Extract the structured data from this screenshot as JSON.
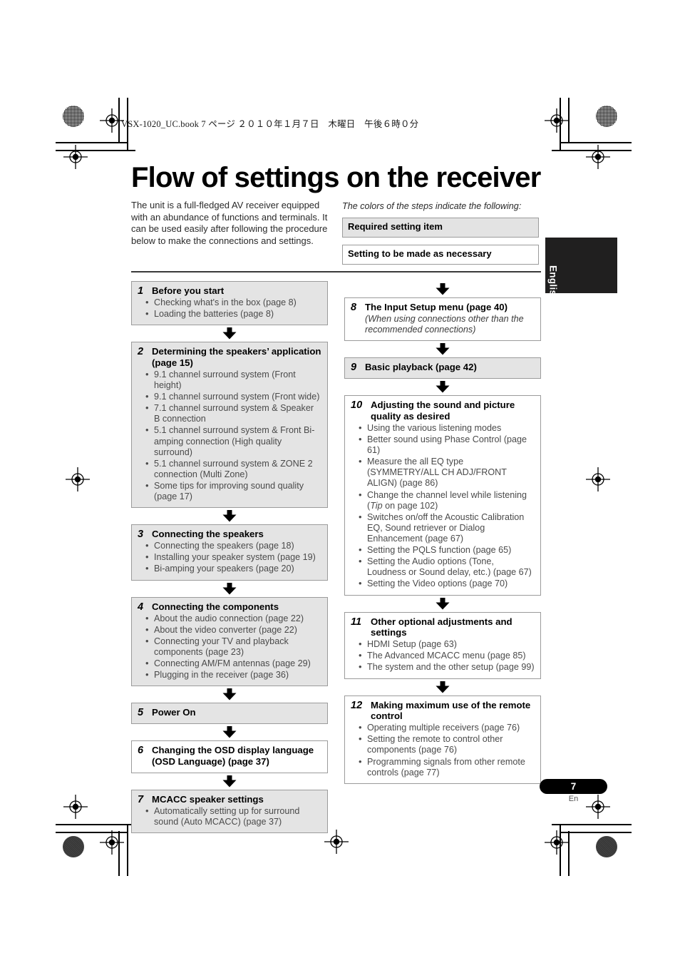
{
  "printer_marks": {
    "book_header": "VSX-1020_UC.book  7 ページ  ２０１０年１月７日　木曜日　午後６時０分"
  },
  "page": {
    "title": "Flow of settings on the receiver",
    "intro": "The unit is a full-fledged AV receiver equipped with an abundance of functions and terminals. It can be used easily after following the procedure below to make the connections and settings.",
    "language_tab": "English",
    "page_number": "7",
    "page_language_code": "En"
  },
  "legend": {
    "caption": "The colors of the steps indicate the following:",
    "required_label": "Required setting item",
    "optional_label": "Setting to be made as necessary",
    "required_color": "#e4e4e4",
    "optional_color": "#ffffff",
    "border_color": "#9b9b9b"
  },
  "flow": {
    "left_column": [
      {
        "number": "1",
        "title": "Before you start",
        "type": "required",
        "items": [
          "Checking what's in the box (page 8)",
          "Loading the batteries (page 8)"
        ]
      },
      {
        "number": "2",
        "title": "Determining the speakers’ application (page 15)",
        "type": "required",
        "items": [
          "9.1 channel surround system (Front height)",
          "9.1 channel surround system (Front wide)",
          "7.1 channel surround system & Speaker B connection",
          "5.1 channel surround system & Front Bi-amping connection (High quality surround)",
          "5.1 channel surround system & ZONE 2 connection (Multi Zone)",
          "Some tips for improving sound quality (page 17)"
        ]
      },
      {
        "number": "3",
        "title": "Connecting the speakers",
        "type": "required",
        "items": [
          "Connecting the speakers (page 18)",
          "Installing your speaker system (page 19)",
          "Bi-amping your speakers (page 20)"
        ]
      },
      {
        "number": "4",
        "title": "Connecting the components",
        "type": "required",
        "items": [
          "About the audio connection (page 22)",
          "About the video converter (page 22)",
          "Connecting your TV and playback components (page 23)",
          "Connecting AM/FM antennas (page 29)",
          "Plugging in the receiver (page 36)"
        ]
      },
      {
        "number": "5",
        "title": "Power On",
        "type": "required",
        "items": []
      },
      {
        "number": "6",
        "title": "Changing the OSD display language (OSD Language) (page 37)",
        "type": "optional",
        "items": []
      },
      {
        "number": "7",
        "title": "MCACC speaker settings",
        "type": "required",
        "items": [
          "Automatically setting up for surround sound (Auto MCACC) (page 37)"
        ]
      }
    ],
    "right_column": [
      {
        "number": "8",
        "title": "The Input Setup menu (page 40)",
        "type": "optional",
        "note": "(When using connections other than the recommended connections)",
        "items": []
      },
      {
        "number": "9",
        "title": "Basic playback (page 42)",
        "type": "required",
        "items": []
      },
      {
        "number": "10",
        "title": "Adjusting the sound and picture quality as desired",
        "type": "optional",
        "items": [
          "Using the various listening modes",
          "Better sound using Phase Control (page 61)",
          "Measure the all EQ type (SYMMETRY/ALL CH ADJ/FRONT ALIGN) (page 86)",
          "Change the channel level while listening (Tip on page 102)",
          "Switches on/off the Acoustic Calibration EQ, Sound retriever or Dialog Enhancement (page 67)",
          "Setting the PQLS function (page 65)",
          "Setting the Audio options (Tone, Loudness or Sound delay, etc.) (page 67)",
          "Setting the Video options (page 70)"
        ]
      },
      {
        "number": "11",
        "title": "Other optional adjustments and settings",
        "type": "optional",
        "items": [
          "HDMI Setup (page 63)",
          "The Advanced MCACC menu (page 85)",
          "The system and the other setup (page 99)"
        ]
      },
      {
        "number": "12",
        "title": "Making maximum use of the remote control",
        "type": "optional",
        "items": [
          "Operating multiple receivers (page 76)",
          "Setting the remote to control other components (page 76)",
          "Programming signals from other remote controls (page 77)"
        ]
      }
    ]
  }
}
